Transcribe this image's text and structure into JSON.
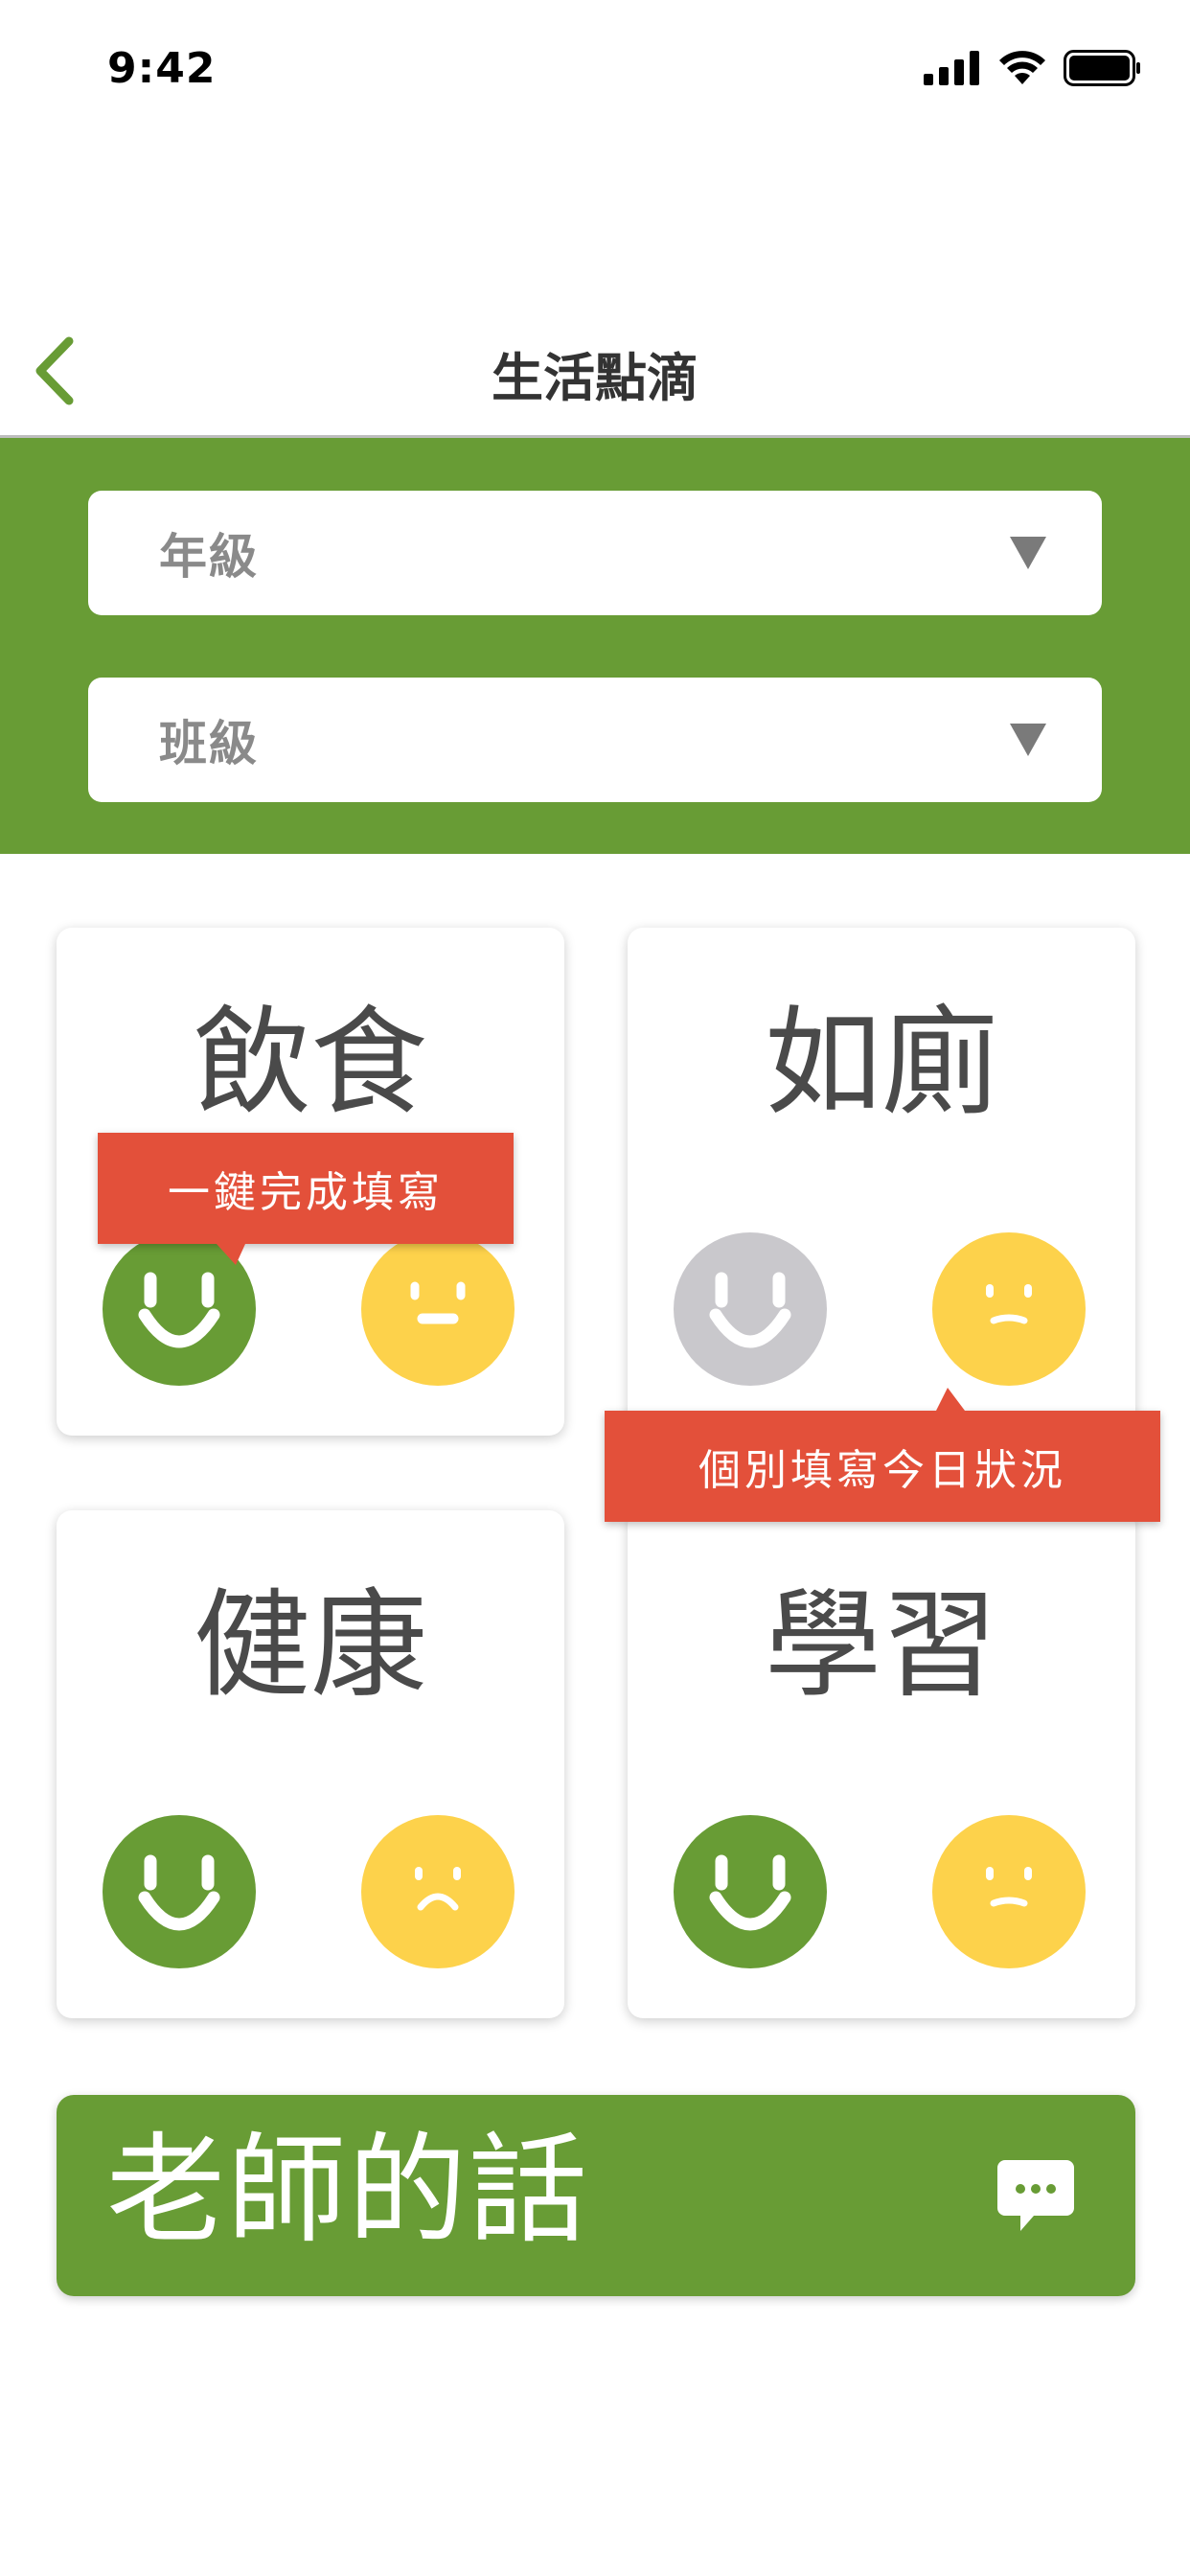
{
  "status_bar": {
    "time": "9:42"
  },
  "nav": {
    "title": "生活點滴"
  },
  "filters": {
    "grade_placeholder": "年級",
    "class_placeholder": "班級"
  },
  "categories": [
    {
      "title": "飲食",
      "left_face": "happy-face-icon",
      "left_state": "selected",
      "right_face": "neutral-face-icon"
    },
    {
      "title": "如廁",
      "left_face": "happy-face-icon",
      "left_state": "unselected",
      "right_face": "slight-frown-face-icon"
    },
    {
      "title": "健康",
      "left_face": "happy-face-icon",
      "left_state": "selected",
      "right_face": "sad-face-icon"
    },
    {
      "title": "學習",
      "left_face": "happy-face-icon",
      "left_state": "selected",
      "right_face": "slight-frown-face-icon"
    }
  ],
  "tooltips": {
    "quick_fill": "一鍵完成填寫",
    "individual_fill": "個別填寫今日狀況"
  },
  "teacher": {
    "label": "老師的話",
    "icon": "chat-bubble-icon"
  },
  "colors": {
    "brand_green": "#689c35",
    "face_yellow": "#fdd24b",
    "face_gray": "#c9c8cc",
    "tooltip_red": "#e3503a"
  }
}
